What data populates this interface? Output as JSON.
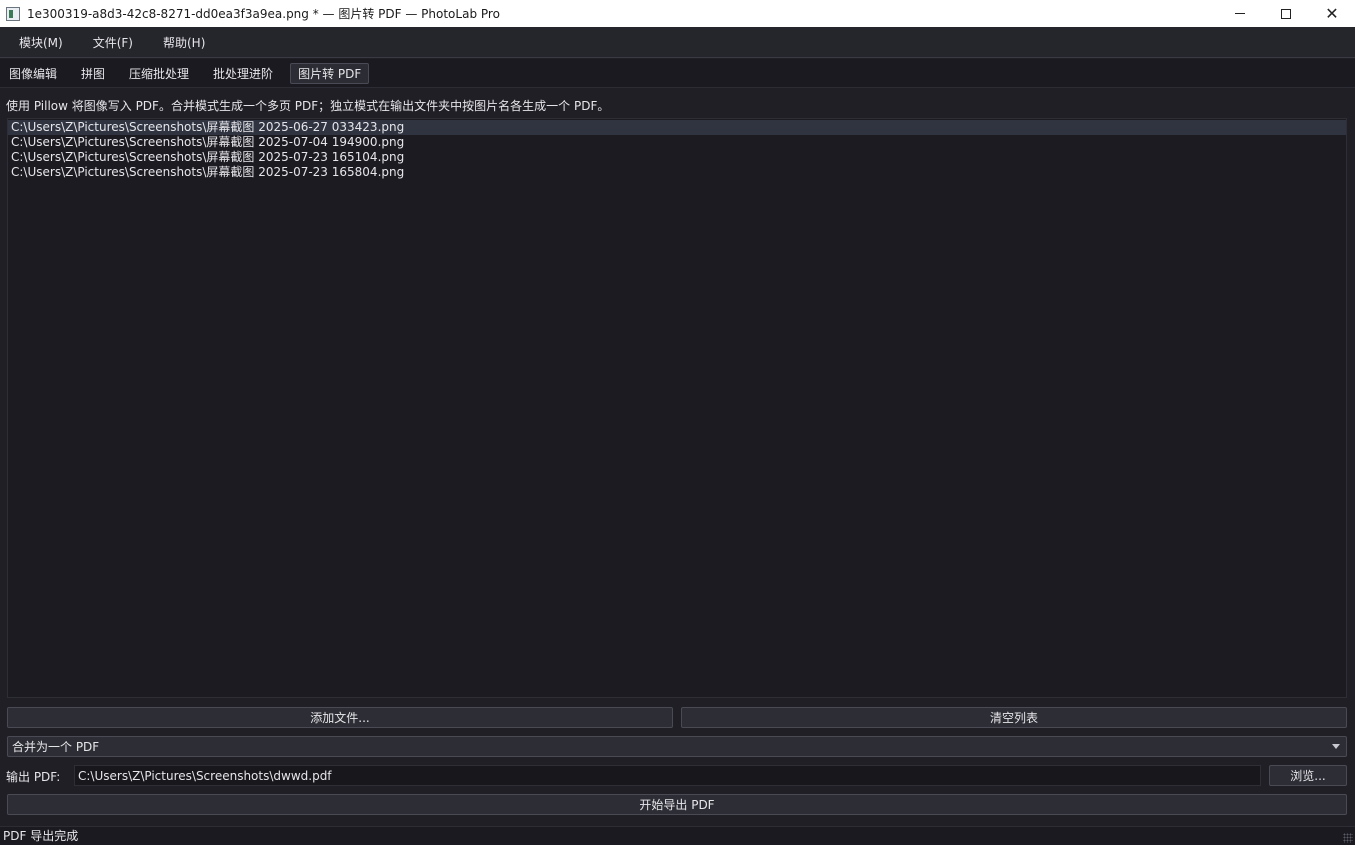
{
  "window": {
    "title": "1e300319-a8d3-42c8-8271-dd0ea3f3a9ea.png * — 图片转 PDF — PhotoLab Pro",
    "minimize": "—",
    "close": "✕"
  },
  "menu": [
    {
      "label": "模块(M)"
    },
    {
      "label": "文件(F)"
    },
    {
      "label": "帮助(H)"
    }
  ],
  "tabs": [
    {
      "label": "图像编辑"
    },
    {
      "label": "拼图"
    },
    {
      "label": "压缩批处理"
    },
    {
      "label": "批处理进阶"
    },
    {
      "label": "图片转 PDF",
      "active": true
    }
  ],
  "description": "使用 Pillow 将图像写入 PDF。合并模式生成一个多页 PDF；独立模式在输出文件夹中按图片名各生成一个 PDF。",
  "files": [
    "C:\\Users\\Z\\Pictures\\Screenshots\\屏幕截图 2025-06-27 033423.png",
    "C:\\Users\\Z\\Pictures\\Screenshots\\屏幕截图 2025-07-04 194900.png",
    "C:\\Users\\Z\\Pictures\\Screenshots\\屏幕截图 2025-07-23 165104.png",
    "C:\\Users\\Z\\Pictures\\Screenshots\\屏幕截图 2025-07-23 165804.png"
  ],
  "buttons": {
    "add_files": "添加文件...",
    "clear_list": "清空列表",
    "browse": "浏览...",
    "start_export": "开始导出 PDF"
  },
  "mode": {
    "selected": "合并为一个 PDF"
  },
  "output": {
    "label": "输出 PDF:",
    "value": "C:\\Users\\Z\\Pictures\\Screenshots\\dwwd.pdf"
  },
  "status": "PDF 导出完成",
  "colors": {
    "background": "#1f1f25",
    "selection": "#2f3440",
    "text": "#e6e6ea"
  }
}
